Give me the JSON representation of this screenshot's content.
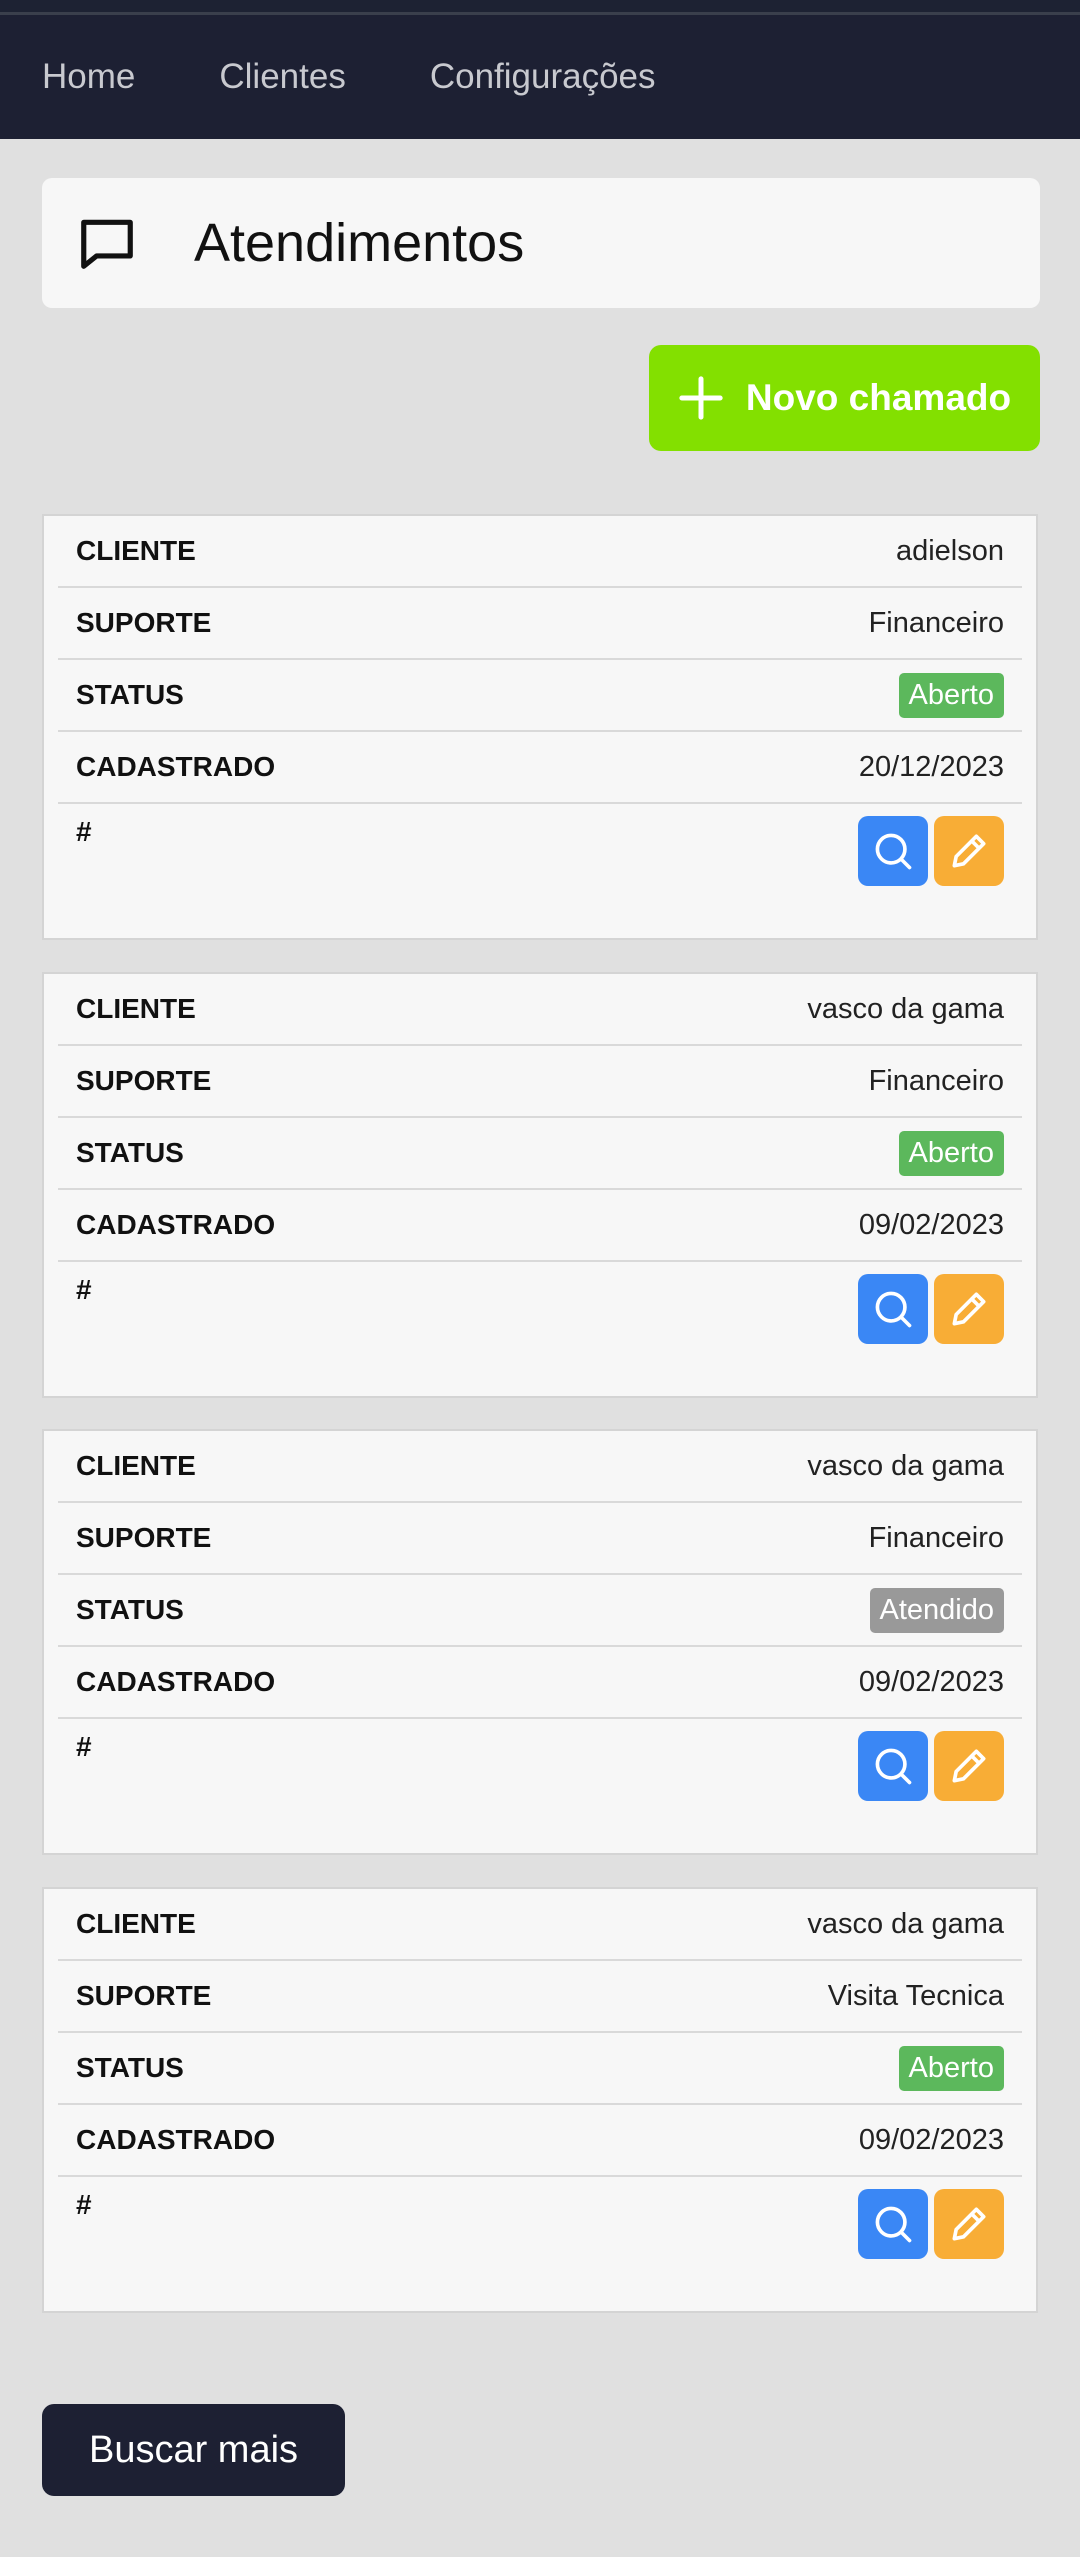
{
  "nav": {
    "items": [
      {
        "label": "Home"
      },
      {
        "label": "Clientes"
      },
      {
        "label": "Configurações"
      }
    ]
  },
  "header": {
    "title": "Atendimentos",
    "icon": "chat-icon"
  },
  "actions": {
    "new_label": "Novo chamado",
    "more_label": "Buscar mais"
  },
  "labels": {
    "cliente": "CLIENTE",
    "suporte": "SUPORTE",
    "status": "STATUS",
    "cadastrado": "CADASTRADO",
    "hash": "#"
  },
  "colors": {
    "navbar": "#1d2033",
    "new_button": "#83e000",
    "aberto": "#5cb85c",
    "atendido": "#999999",
    "view": "#3a87f5",
    "edit": "#f8ad36"
  },
  "tickets": [
    {
      "cliente": "adielson",
      "suporte": "Financeiro",
      "status": "Aberto",
      "status_kind": "aberto",
      "cadastrado": "20/12/2023"
    },
    {
      "cliente": "vasco da gama",
      "suporte": "Financeiro",
      "status": "Aberto",
      "status_kind": "aberto",
      "cadastrado": "09/02/2023"
    },
    {
      "cliente": "vasco da gama",
      "suporte": "Financeiro",
      "status": "Atendido",
      "status_kind": "atendido",
      "cadastrado": "09/02/2023"
    },
    {
      "cliente": "vasco da gama",
      "suporte": "Visita Tecnica",
      "status": "Aberto",
      "status_kind": "aberto",
      "cadastrado": "09/02/2023"
    }
  ]
}
